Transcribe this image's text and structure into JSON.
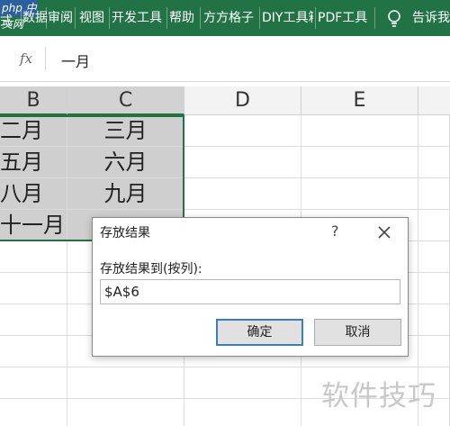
{
  "ribbon": {
    "logo": "php 中文网",
    "tabs": [
      "式",
      "数据",
      "审阅",
      "视图",
      "开发工具",
      "帮助",
      "方方格子",
      "DIY工具箱",
      "PDF工具",
      "告诉我"
    ],
    "colors": {
      "background": "#217346",
      "text": "#ffffff"
    },
    "tell_me_icon": "lightbulb-icon"
  },
  "formula_bar": {
    "fx_label": "fx",
    "value": "一月"
  },
  "columns": [
    "B",
    "C",
    "D",
    "E"
  ],
  "cells": {
    "r1": [
      "二月",
      "三月"
    ],
    "r2": [
      "五月",
      "六月"
    ],
    "r3": [
      "八月",
      "九月"
    ],
    "r4": [
      "十一月",
      ""
    ]
  },
  "dialog": {
    "title": "存放结果",
    "help": "?",
    "close_icon": "close-icon",
    "label": "存放结果到(按列):",
    "input_value": "$A$6",
    "ok_label": "确定",
    "cancel_label": "取消"
  },
  "watermark": "软件技巧"
}
